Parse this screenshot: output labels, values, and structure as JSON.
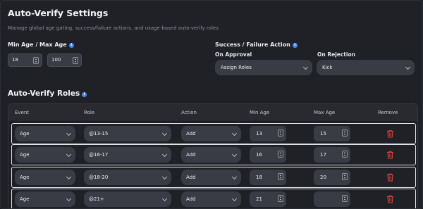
{
  "header": {
    "title": "Auto-Verify Settings",
    "subtitle": "Manage global age gating, success/failure actions, and usage-based auto-verify roles"
  },
  "age_range": {
    "label": "Min Age / Max Age",
    "min_value": "18",
    "max_value": "100"
  },
  "actions": {
    "label": "Success / Failure Action",
    "approval_label": "On Approval",
    "approval_value": "Assign Roles",
    "rejection_label": "On Rejection",
    "rejection_value": "Kick"
  },
  "roles": {
    "title": "Auto-Verify Roles",
    "columns": {
      "event": "Event",
      "role": "Role",
      "action": "Action",
      "min_age": "Min Age",
      "max_age": "Max Age",
      "remove": "Remove"
    },
    "rows": [
      {
        "event": "Age",
        "role": "@13-15",
        "action": "Add",
        "min": "13",
        "max": "15"
      },
      {
        "event": "Age",
        "role": "@16-17",
        "action": "Add",
        "min": "16",
        "max": "17"
      },
      {
        "event": "Age",
        "role": "@18-20",
        "action": "Add",
        "min": "18",
        "max": "20"
      },
      {
        "event": "Age",
        "role": "@21+",
        "action": "Add",
        "min": "21",
        "max": ""
      }
    ]
  },
  "colors": {
    "accent": "#4b87ff",
    "danger": "#e0413b",
    "background": "#202126"
  },
  "icons": {
    "info": "info-icon",
    "remove": "trash-icon",
    "dropdown": "chevron-down-icon",
    "stepper": "stepper-icon"
  }
}
